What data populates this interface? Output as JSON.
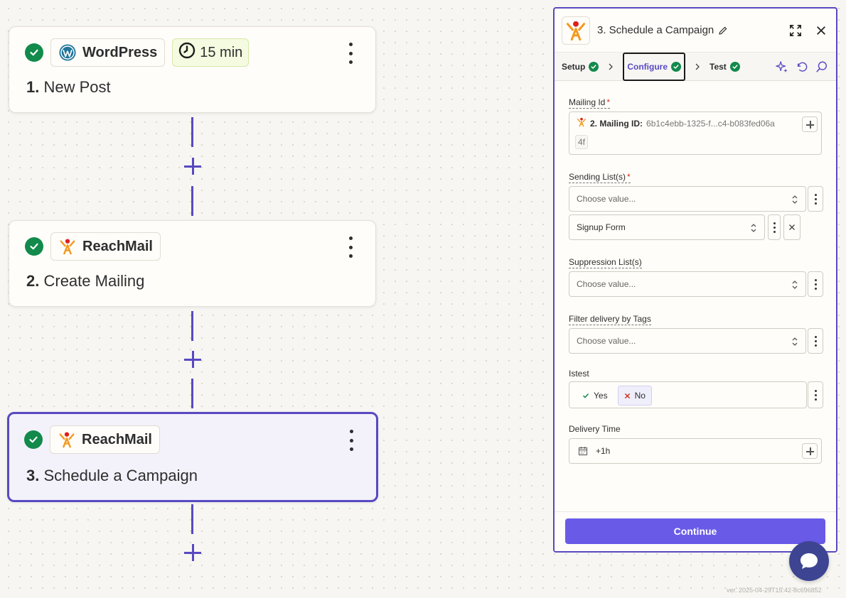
{
  "canvas": {
    "steps": [
      {
        "app": "WordPress",
        "number": "1.",
        "title": "New Post",
        "badge": "15 min"
      },
      {
        "app": "ReachMail",
        "number": "2.",
        "title": "Create Mailing"
      },
      {
        "app": "ReachMail",
        "number": "3.",
        "title": "Schedule a Campaign"
      }
    ]
  },
  "panel": {
    "title": "3. Schedule a Campaign",
    "tabs": [
      {
        "label": "Setup"
      },
      {
        "label": "Configure"
      },
      {
        "label": "Test"
      }
    ],
    "fields": {
      "mailing_id": {
        "label": "Mailing Id",
        "required_mark": "*",
        "token_label": "2. Mailing ID:",
        "token_value": "6b1c4ebb-1325-f...c4-b083fed06a",
        "token_tail": "4f"
      },
      "sending_lists": {
        "label": "Sending List(s)",
        "required_mark": "*",
        "placeholder": "Choose value...",
        "selected": "Signup Form"
      },
      "suppression_lists": {
        "label": "Suppression List(s)",
        "placeholder": "Choose value..."
      },
      "filter_tags": {
        "label": "Filter delivery by Tags",
        "placeholder": "Choose value..."
      },
      "istest": {
        "label": "Istest",
        "yes": "Yes",
        "no": "No",
        "selected": "No"
      },
      "delivery_time": {
        "label": "Delivery Time",
        "value": "+1h"
      }
    },
    "continue_label": "Continue"
  },
  "version": "ver. 2025-04-29T15:42-8c696852",
  "colors": {
    "accent": "#5849c2",
    "button": "#695be8",
    "success": "#128a4c",
    "chat": "#3d4592"
  }
}
